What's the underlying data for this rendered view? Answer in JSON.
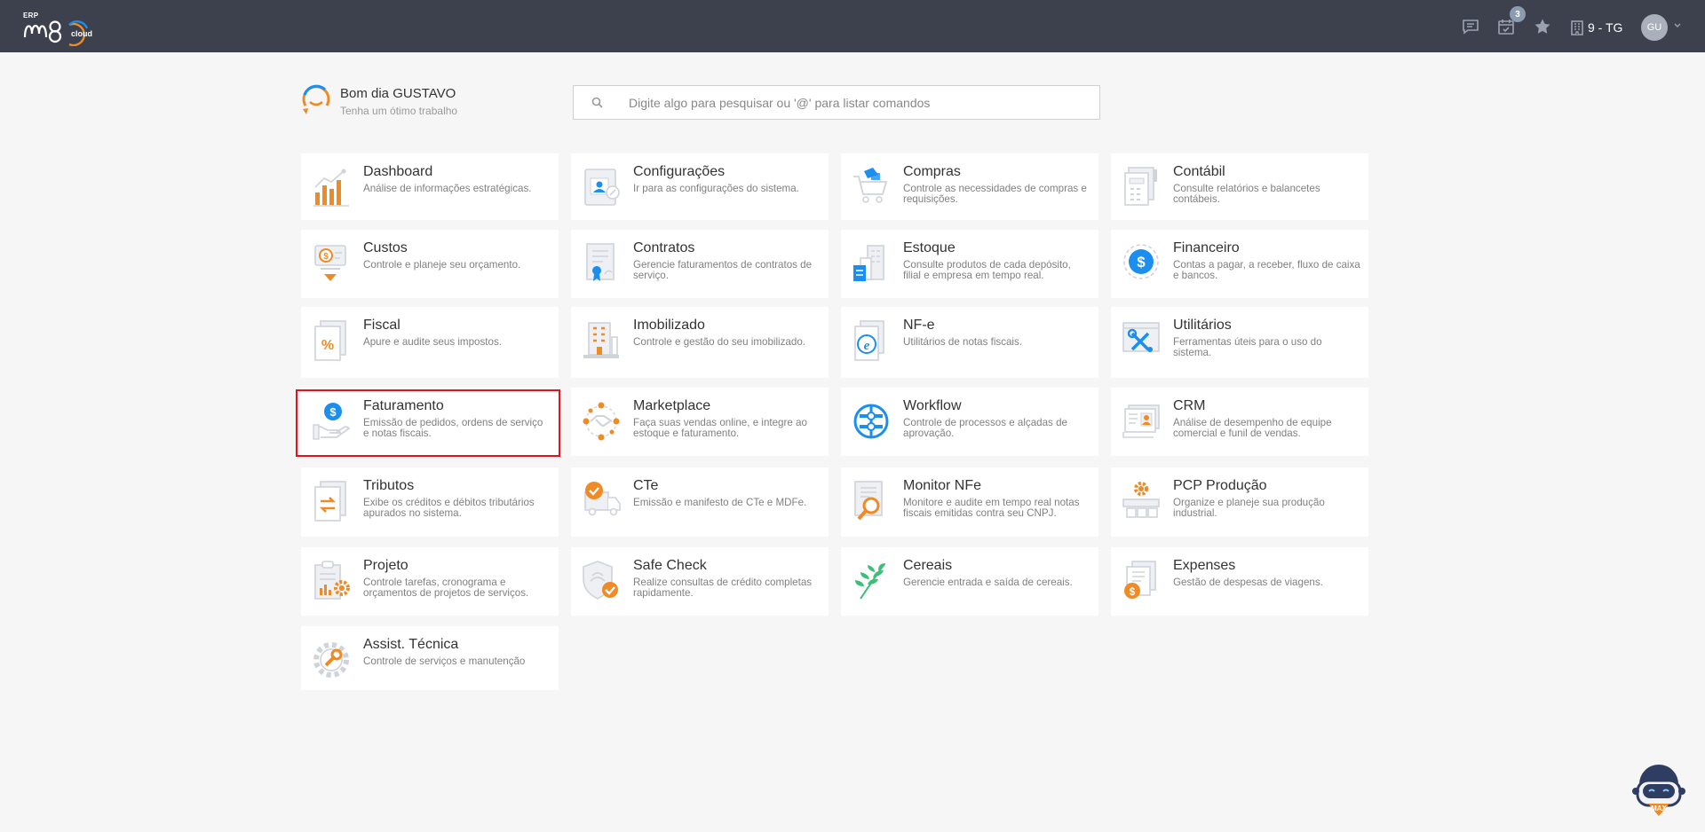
{
  "brand": {
    "erp": "ERP",
    "cloud": "cloud"
  },
  "topbar": {
    "notifications_badge": "3",
    "company": "9 - TG",
    "avatar_initials": "GU",
    "icons": [
      "chat-icon",
      "calendar-check-icon",
      "star-icon",
      "building-icon",
      "chevron-down-icon"
    ]
  },
  "greeting": {
    "title": "Bom dia GUSTAVO",
    "subtitle": "Tenha um ótimo trabalho"
  },
  "search": {
    "placeholder": "Digite algo para pesquisar ou '@' para listar comandos",
    "value": ""
  },
  "modules": [
    {
      "title": "Dashboard",
      "desc": "Análise de informações estratégicas.",
      "icon": "bar-chart-icon"
    },
    {
      "title": "Configurações",
      "desc": "Ir para as configurações do sistema.",
      "icon": "settings-profile-icon"
    },
    {
      "title": "Compras",
      "desc": "Controle as necessidades de compras e requisições.",
      "icon": "shopping-cart-icon"
    },
    {
      "title": "Contábil",
      "desc": "Consulte relatórios e balancetes contábeis.",
      "icon": "calculator-document-icon"
    },
    {
      "title": "Custos",
      "desc": "Controle e planeje seu orçamento.",
      "icon": "cost-coin-icon"
    },
    {
      "title": "Contratos",
      "desc": "Gerencie faturamentos de contratos de serviço.",
      "icon": "contract-icon"
    },
    {
      "title": "Estoque",
      "desc": "Consulte produtos de cada depósito, filial e empresa em tempo real.",
      "icon": "warehouse-icon"
    },
    {
      "title": "Financeiro",
      "desc": "Contas a pagar, a receber, fluxo de caixa e bancos.",
      "icon": "dollar-circle-icon"
    },
    {
      "title": "Fiscal",
      "desc": "Apure e audite seus impostos.",
      "icon": "percent-document-icon"
    },
    {
      "title": "Imobilizado",
      "desc": "Controle e gestão do seu imobilizado.",
      "icon": "building-asset-icon"
    },
    {
      "title": "NF-e",
      "desc": "Utilitários de notas fiscais.",
      "icon": "e-invoice-icon"
    },
    {
      "title": "Utilitários",
      "desc": "Ferramentas úteis para o uso do sistema.",
      "icon": "tools-icon"
    },
    {
      "title": "Faturamento",
      "desc": "Emissão de pedidos, ordens de serviço e notas fiscais.",
      "icon": "billing-hand-icon"
    },
    {
      "title": "Marketplace",
      "desc": "Faça suas vendas online, e integre ao estoque e faturamento.",
      "icon": "handshake-network-icon"
    },
    {
      "title": "Workflow",
      "desc": "Controle de processos e alçadas de aprovação.",
      "icon": "workflow-icon"
    },
    {
      "title": "CRM",
      "desc": "Análise de desempenho de equipe comercial e funil de vendas.",
      "icon": "crm-contacts-icon"
    },
    {
      "title": "Tributos",
      "desc": "Exibe os créditos e débitos tributários apurados no sistema.",
      "icon": "tax-transfer-icon"
    },
    {
      "title": "CTe",
      "desc": "Emissão e manifesto de CTe e MDFe.",
      "icon": "truck-check-icon"
    },
    {
      "title": "Monitor NFe",
      "desc": "Monitore e audite em tempo real notas fiscais emitidas contra seu CNPJ.",
      "icon": "magnifier-document-icon"
    },
    {
      "title": "PCP Produção",
      "desc": "Organize e planeje sua produção industrial.",
      "icon": "production-gear-icon"
    },
    {
      "title": "Projeto",
      "desc": "Controle tarefas, cronograma e orçamentos de projetos de serviços.",
      "icon": "project-clipboard-icon"
    },
    {
      "title": "Safe Check",
      "desc": "Realize consultas de crédito completas rapidamente.",
      "icon": "shield-check-icon"
    },
    {
      "title": "Cereais",
      "desc": "Gerencie entrada e saída de cereais.",
      "icon": "grain-leaf-icon"
    },
    {
      "title": "Expenses",
      "desc": "Gestão de despesas de viagens.",
      "icon": "expenses-icon"
    },
    {
      "title": "Assist. Técnica",
      "desc": "Controle de serviços e manutenção",
      "icon": "wrench-gear-icon"
    }
  ],
  "highlighted_module": "Faturamento",
  "assistant": {
    "label": "MAX"
  },
  "colors": {
    "topbar": "#3d414d",
    "accent_orange": "#f08a24",
    "accent_blue": "#1a8ff0",
    "highlight": "#e1141e"
  }
}
